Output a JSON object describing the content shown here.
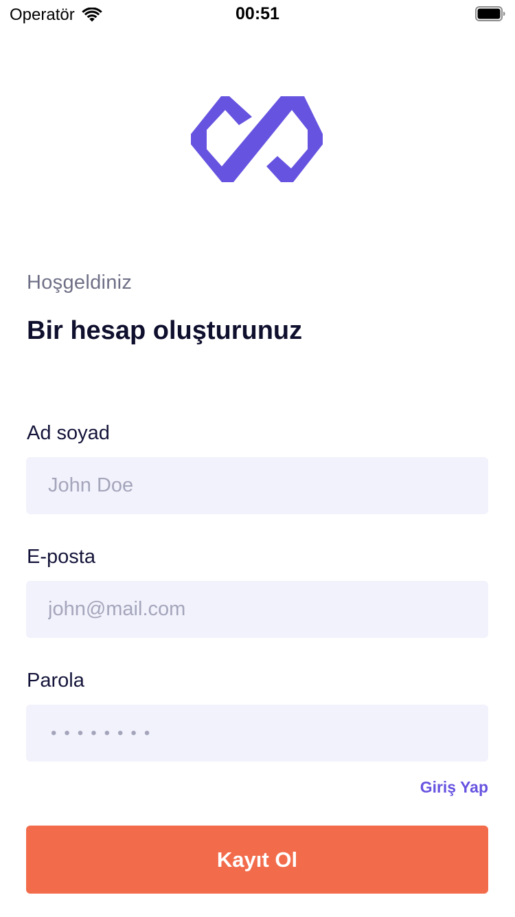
{
  "status_bar": {
    "carrier": "Operatör",
    "time": "00:51",
    "wifi_icon": "wifi-icon",
    "battery_icon": "battery-icon"
  },
  "brand": {
    "logo_icon": "infinity-logo-icon",
    "accent_color": "#6653e0"
  },
  "header": {
    "welcome": "Hoşgeldiniz",
    "title": "Bir hesap oluşturunuz"
  },
  "form": {
    "name": {
      "label": "Ad soyad",
      "placeholder": "John Doe",
      "value": ""
    },
    "email": {
      "label": "E-posta",
      "placeholder": "john@mail.com",
      "value": ""
    },
    "password": {
      "label": "Parola",
      "placeholder": "••••••••",
      "value": ""
    }
  },
  "login_link": "Giriş Yap",
  "register_button": {
    "label": "Kayıt Ol",
    "color": "#f26c4c"
  }
}
